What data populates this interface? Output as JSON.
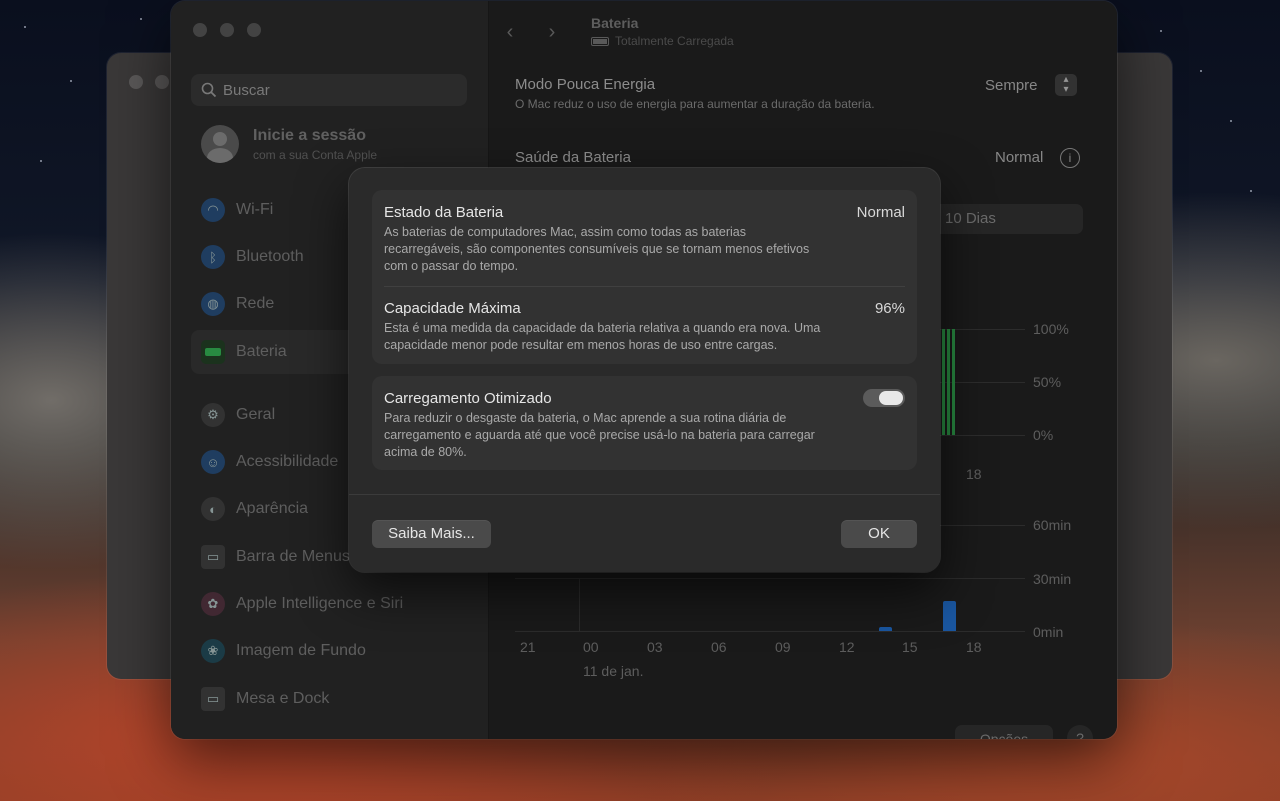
{
  "window": {
    "title": "Bateria",
    "subtitle": "Totalmente Carregada",
    "search_placeholder": "Buscar"
  },
  "account": {
    "title": "Inicie a sessão",
    "subtitle": "com a sua Conta Apple"
  },
  "sidebar": {
    "items": [
      {
        "label": "Wi-Fi",
        "icon": "wifi-icon"
      },
      {
        "label": "Bluetooth",
        "icon": "bluetooth-icon"
      },
      {
        "label": "Rede",
        "icon": "globe-icon"
      },
      {
        "label": "Bateria",
        "icon": "battery-icon",
        "active": true
      },
      {
        "label": "Geral",
        "icon": "gear-icon"
      },
      {
        "label": "Acessibilidade",
        "icon": "accessibility-icon"
      },
      {
        "label": "Aparência",
        "icon": "appearance-icon"
      },
      {
        "label": "Barra de Menus",
        "icon": "menubar-icon"
      },
      {
        "label": "Apple Intelligence e Siri",
        "icon": "siri-icon"
      },
      {
        "label": "Imagem de Fundo",
        "icon": "wallpaper-icon"
      },
      {
        "label": "Mesa e Dock",
        "icon": "dock-icon"
      }
    ]
  },
  "content": {
    "low_power": {
      "label": "Modo Pouca Energia",
      "description": "O Mac reduz o uso de energia para aumentar a duração da bateria.",
      "value": "Sempre"
    },
    "health": {
      "label": "Saúde da Bateria",
      "value": "Normal"
    },
    "range_tab": "10 Dias",
    "level_chart": {
      "y_ticks": [
        "100%",
        "50%",
        "0%"
      ],
      "x_tick": "18"
    },
    "usage_chart": {
      "y_ticks": [
        "60min",
        "30min",
        "0min"
      ],
      "x_ticks": [
        "21",
        "00",
        "03",
        "06",
        "09",
        "12",
        "15",
        "18"
      ],
      "date_label": "11 de jan."
    },
    "options_button": "Opções",
    "help_button": "?"
  },
  "chart_data": [
    {
      "type": "bar",
      "title": "",
      "ylabel": "",
      "ylim": [
        0,
        100
      ],
      "y_ticks": [
        "100%",
        "50%",
        "0%"
      ],
      "series": [
        {
          "values": [
            100,
            100,
            100,
            100
          ]
        }
      ],
      "categories": [
        "18"
      ],
      "color": "#2e9e4b"
    },
    {
      "type": "bar",
      "title": "",
      "ylabel": "",
      "ylim": [
        0,
        60
      ],
      "y_ticks": [
        "60min",
        "30min",
        "0min"
      ],
      "categories": [
        "21",
        "00",
        "03",
        "06",
        "09",
        "12",
        "15",
        "18"
      ],
      "series": [
        {
          "values": [
            0,
            0,
            0,
            0,
            0,
            0,
            2,
            17
          ]
        }
      ],
      "color": "#1e63b8",
      "date_label": "11 de jan."
    }
  ],
  "sheet": {
    "state": {
      "title": "Estado da Bateria",
      "value": "Normal",
      "description": "As baterias de computadores Mac, assim como todas as baterias recarregáveis, são componentes consumíveis que se tornam menos efetivos com o passar do tempo."
    },
    "capacity": {
      "title": "Capacidade Máxima",
      "value": "96%",
      "description": "Esta é uma medida da capacidade da bateria relativa a quando era nova. Uma capacidade menor pode resultar em menos horas de uso entre cargas."
    },
    "optimized": {
      "title": "Carregamento Otimizado",
      "enabled": true,
      "description": "Para reduzir o desgaste da bateria, o Mac aprende a sua rotina diária de carregamento e aguarda até que você precise usá-lo na bateria para carregar acima de 80%."
    },
    "learn_more_button": "Saiba Mais...",
    "ok_button": "OK"
  }
}
